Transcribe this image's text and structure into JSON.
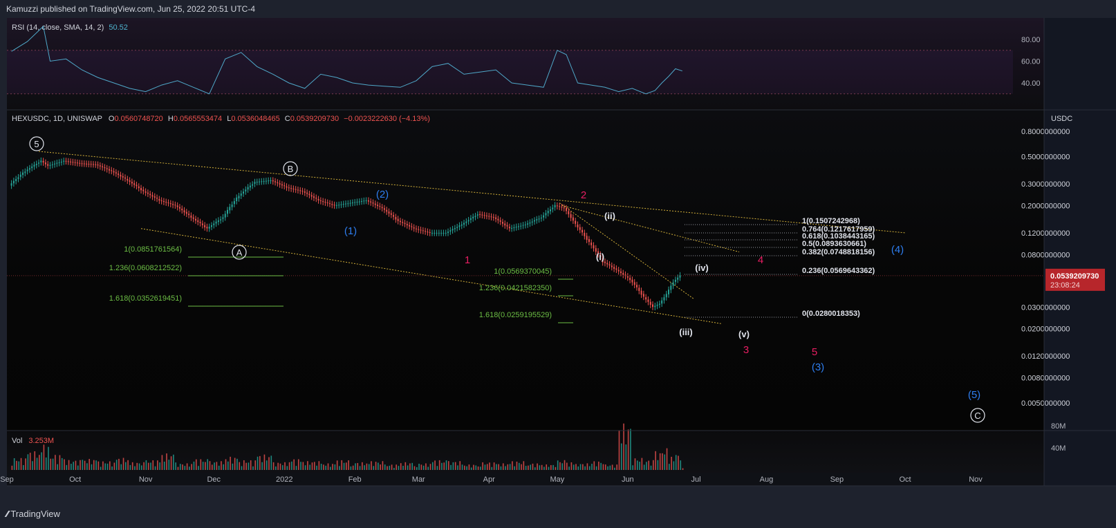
{
  "publisher_line": "Kamuzzi published on TradingView.com, Jun 25, 2022 20:51 UTC-4",
  "footer_brand": "TradingView",
  "rsi": {
    "label": "RSI (14, close, SMA, 14, 2)",
    "value": "50.52",
    "ticks": [
      "80.00",
      "60.00",
      "40.00"
    ]
  },
  "main": {
    "symbol_line": "HEXUSDC, 1D, UNISWAP",
    "open_label": "O",
    "open": "0.0560748720",
    "high_label": "H",
    "high": "0.0565553474",
    "low_label": "L",
    "low": "0.0536048465",
    "close_label": "C",
    "close": "0.0539209730",
    "change": "−0.0023222630 (−4.13%)",
    "currency": "USDC",
    "price_ticks": [
      "0.8000000000",
      "0.5000000000",
      "0.3000000000",
      "0.2000000000",
      "0.1200000000",
      "0.0800000000",
      "0.0300000000",
      "0.0200000000",
      "0.0120000000",
      "0.0080000000",
      "0.0050000000"
    ],
    "last_price_tag": "0.0539209730",
    "countdown": "23:08:24"
  },
  "volume": {
    "label": "Vol",
    "value": "3.253M",
    "ticks": [
      "80M",
      "40M"
    ]
  },
  "time_axis": [
    "Sep",
    "Oct",
    "Nov",
    "Dec",
    "2022",
    "Feb",
    "Mar",
    "Apr",
    "May",
    "Jun",
    "Jul",
    "Aug",
    "Sep",
    "Oct",
    "Nov"
  ],
  "wave_labels": {
    "circled": [
      "5",
      "B",
      "A",
      "C"
    ],
    "blue": [
      "(1)",
      "(2)",
      "(3)",
      "(4)",
      "(5)"
    ],
    "red": [
      "1",
      "2",
      "3",
      "4",
      "5"
    ],
    "white": [
      "(i)",
      "(ii)",
      "(iii)",
      "(iv)",
      "(v)"
    ]
  },
  "fib_left": [
    "1(0.0851761564)",
    "1.236(0.0608212522)",
    "1.618(0.0352619451)"
  ],
  "fib_mid": [
    "1(0.0569370045)",
    "1.236(0.0421582350)",
    "1.618(0.0259195529)"
  ],
  "fib_right": [
    "1(0.1507242968)",
    "0.764(0.1217617959)",
    "0.618(0.1038443165)",
    "0.5(0.0893630661)",
    "0.382(0.0748818156)",
    "0.236(0.0569643362)",
    "0(0.0280018353)"
  ],
  "colors": {
    "bull": "#26a69a",
    "bear": "#ef5350",
    "rsi_line": "#4fa8c9",
    "fib_green": "#6dbf45",
    "fib_white": "#e0e3eb",
    "wave_blue": "#2e7ef0",
    "wave_red": "#e91e63",
    "trend_yellow": "#d4b13a",
    "accent_tag": "#b7262b"
  },
  "chart_data": {
    "type": "line",
    "title": "HEXUSDC, 1D, UNISWAP",
    "ylabel": "USDC",
    "yscale": "log",
    "ylim": [
      0.004,
      1.0
    ],
    "x_axis_labels": [
      "Sep",
      "Oct",
      "Nov",
      "Dec",
      "2022",
      "Feb",
      "Mar",
      "Apr",
      "May",
      "Jun",
      "Jul",
      "Aug",
      "Sep",
      "Oct",
      "Nov"
    ],
    "x_months": [
      "2021-09",
      "2021-10",
      "2021-11",
      "2021-12",
      "2022-01",
      "2022-02",
      "2022-03",
      "2022-04",
      "2022-05",
      "2022-06",
      "2022-07",
      "2022-08",
      "2022-09",
      "2022-10",
      "2022-11"
    ],
    "series": [
      {
        "name": "HEXUSDC",
        "x": [
          "2021-09-03",
          "2021-09-10",
          "2021-09-17",
          "2021-09-20",
          "2021-09-27",
          "2021-10-04",
          "2021-10-11",
          "2021-10-18",
          "2021-10-25",
          "2021-11-01",
          "2021-11-08",
          "2021-11-15",
          "2021-11-22",
          "2021-11-29",
          "2021-12-06",
          "2021-12-13",
          "2021-12-20",
          "2021-12-27",
          "2022-01-03",
          "2022-01-10",
          "2022-01-17",
          "2022-01-24",
          "2022-01-31",
          "2022-02-07",
          "2022-02-14",
          "2022-02-21",
          "2022-02-28",
          "2022-03-07",
          "2022-03-14",
          "2022-03-21",
          "2022-03-28",
          "2022-04-04",
          "2022-04-11",
          "2022-04-18",
          "2022-04-25",
          "2022-05-01",
          "2022-05-05",
          "2022-05-10",
          "2022-05-16",
          "2022-05-22",
          "2022-05-28",
          "2022-06-03",
          "2022-06-09",
          "2022-06-13",
          "2022-06-16",
          "2022-06-19",
          "2022-06-22",
          "2022-06-25"
        ],
        "values": [
          0.29,
          0.38,
          0.46,
          0.42,
          0.46,
          0.44,
          0.43,
          0.38,
          0.32,
          0.26,
          0.22,
          0.2,
          0.16,
          0.13,
          0.16,
          0.24,
          0.31,
          0.32,
          0.28,
          0.26,
          0.22,
          0.2,
          0.21,
          0.22,
          0.19,
          0.15,
          0.13,
          0.12,
          0.12,
          0.14,
          0.17,
          0.16,
          0.13,
          0.14,
          0.16,
          0.2,
          0.19,
          0.14,
          0.1,
          0.07,
          0.06,
          0.05,
          0.036,
          0.03,
          0.032,
          0.038,
          0.048,
          0.054
        ]
      }
    ],
    "rsi": {
      "name": "RSI (14, close, SMA, 14, 2)",
      "ylim": [
        20,
        90
      ],
      "values": [
        69,
        78,
        92,
        60,
        62,
        52,
        45,
        40,
        35,
        32,
        38,
        42,
        36,
        30,
        62,
        68,
        55,
        48,
        40,
        35,
        48,
        45,
        40,
        38,
        37,
        36,
        42,
        55,
        58,
        48,
        50,
        52,
        40,
        38,
        36,
        70,
        66,
        40,
        38,
        36,
        32,
        35,
        30,
        33,
        40,
        46,
        53,
        51
      ]
    },
    "volume": {
      "name": "Vol",
      "ylim": [
        0,
        100
      ],
      "unit": "M",
      "values": [
        22,
        34,
        46,
        28,
        18,
        20,
        16,
        22,
        14,
        18,
        30,
        12,
        20,
        16,
        24,
        18,
        28,
        14,
        20,
        16,
        12,
        18,
        14,
        16,
        10,
        14,
        12,
        18,
        16,
        10,
        14,
        12,
        16,
        12,
        10,
        18,
        14,
        12,
        16,
        10,
        84,
        22,
        18,
        34,
        40,
        24,
        30,
        3.253
      ]
    }
  }
}
